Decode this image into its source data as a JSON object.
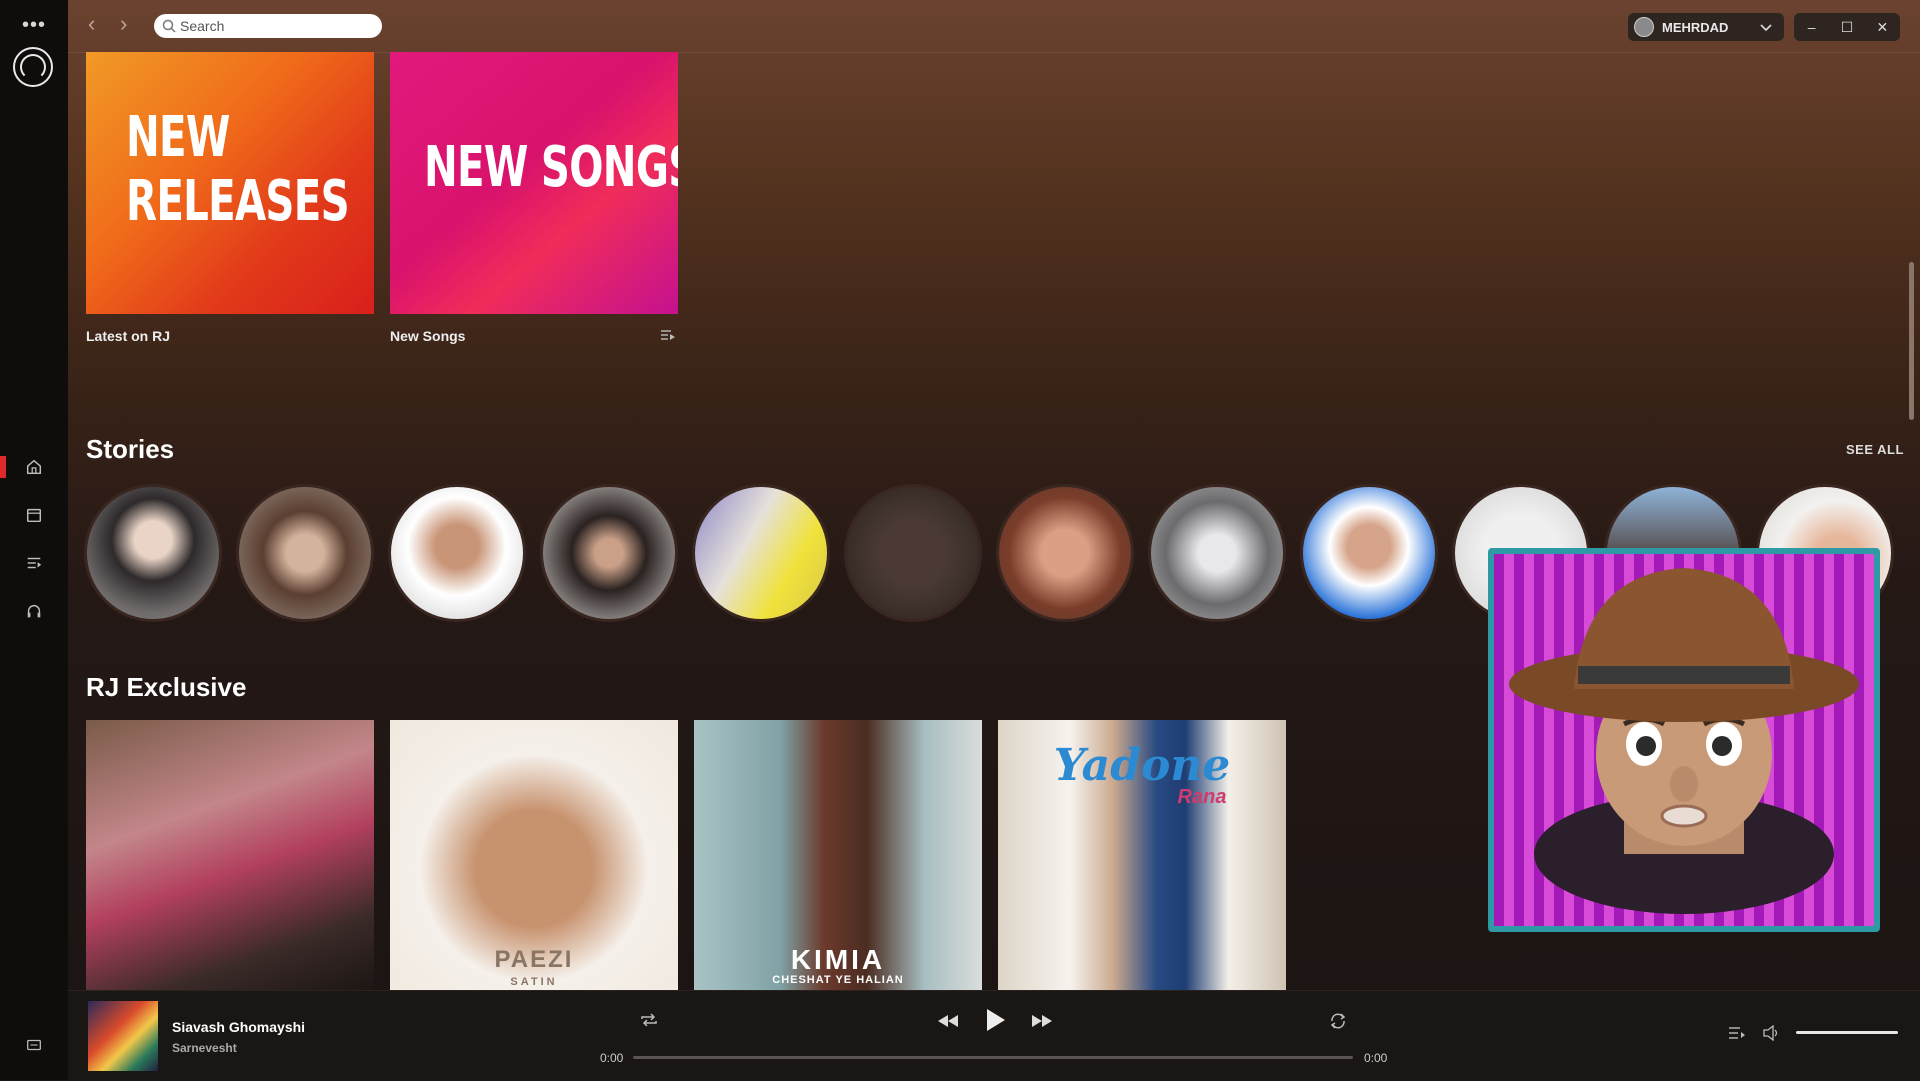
{
  "app": {
    "search_placeholder": "Search",
    "user_name": "MEHRDAD",
    "nav_icons": [
      "home-icon",
      "calendar-icon",
      "playlist-icon",
      "headphones-icon"
    ]
  },
  "tiles": [
    {
      "art_text_line1": "NEW",
      "art_text_line2": "RELEASES",
      "caption": "Latest on RJ"
    },
    {
      "art_text": "NEW SONGS",
      "caption": "New Songs"
    }
  ],
  "stories": {
    "title": "Stories",
    "see_all": "SEE ALL",
    "count": 12
  },
  "exclusive": {
    "title": "RJ Exclusive",
    "items": [
      {
        "label": ""
      },
      {
        "label": "PAEZI",
        "sublabel": "SATIN"
      },
      {
        "label": "KIMIA",
        "sublabel": "CHESHAT YE HALIAN"
      },
      {
        "label": "Yadone",
        "sublabel": "Rana"
      }
    ]
  },
  "player": {
    "track_title": "Siavash Ghomayshi",
    "track_artist": "Sarnevesht",
    "time_elapsed": "0:00",
    "time_total": "0:00",
    "progress": 0,
    "volume": 1.0
  },
  "colors": {
    "accent": "#e02a2a",
    "pip_border": "#2d9aa5"
  }
}
